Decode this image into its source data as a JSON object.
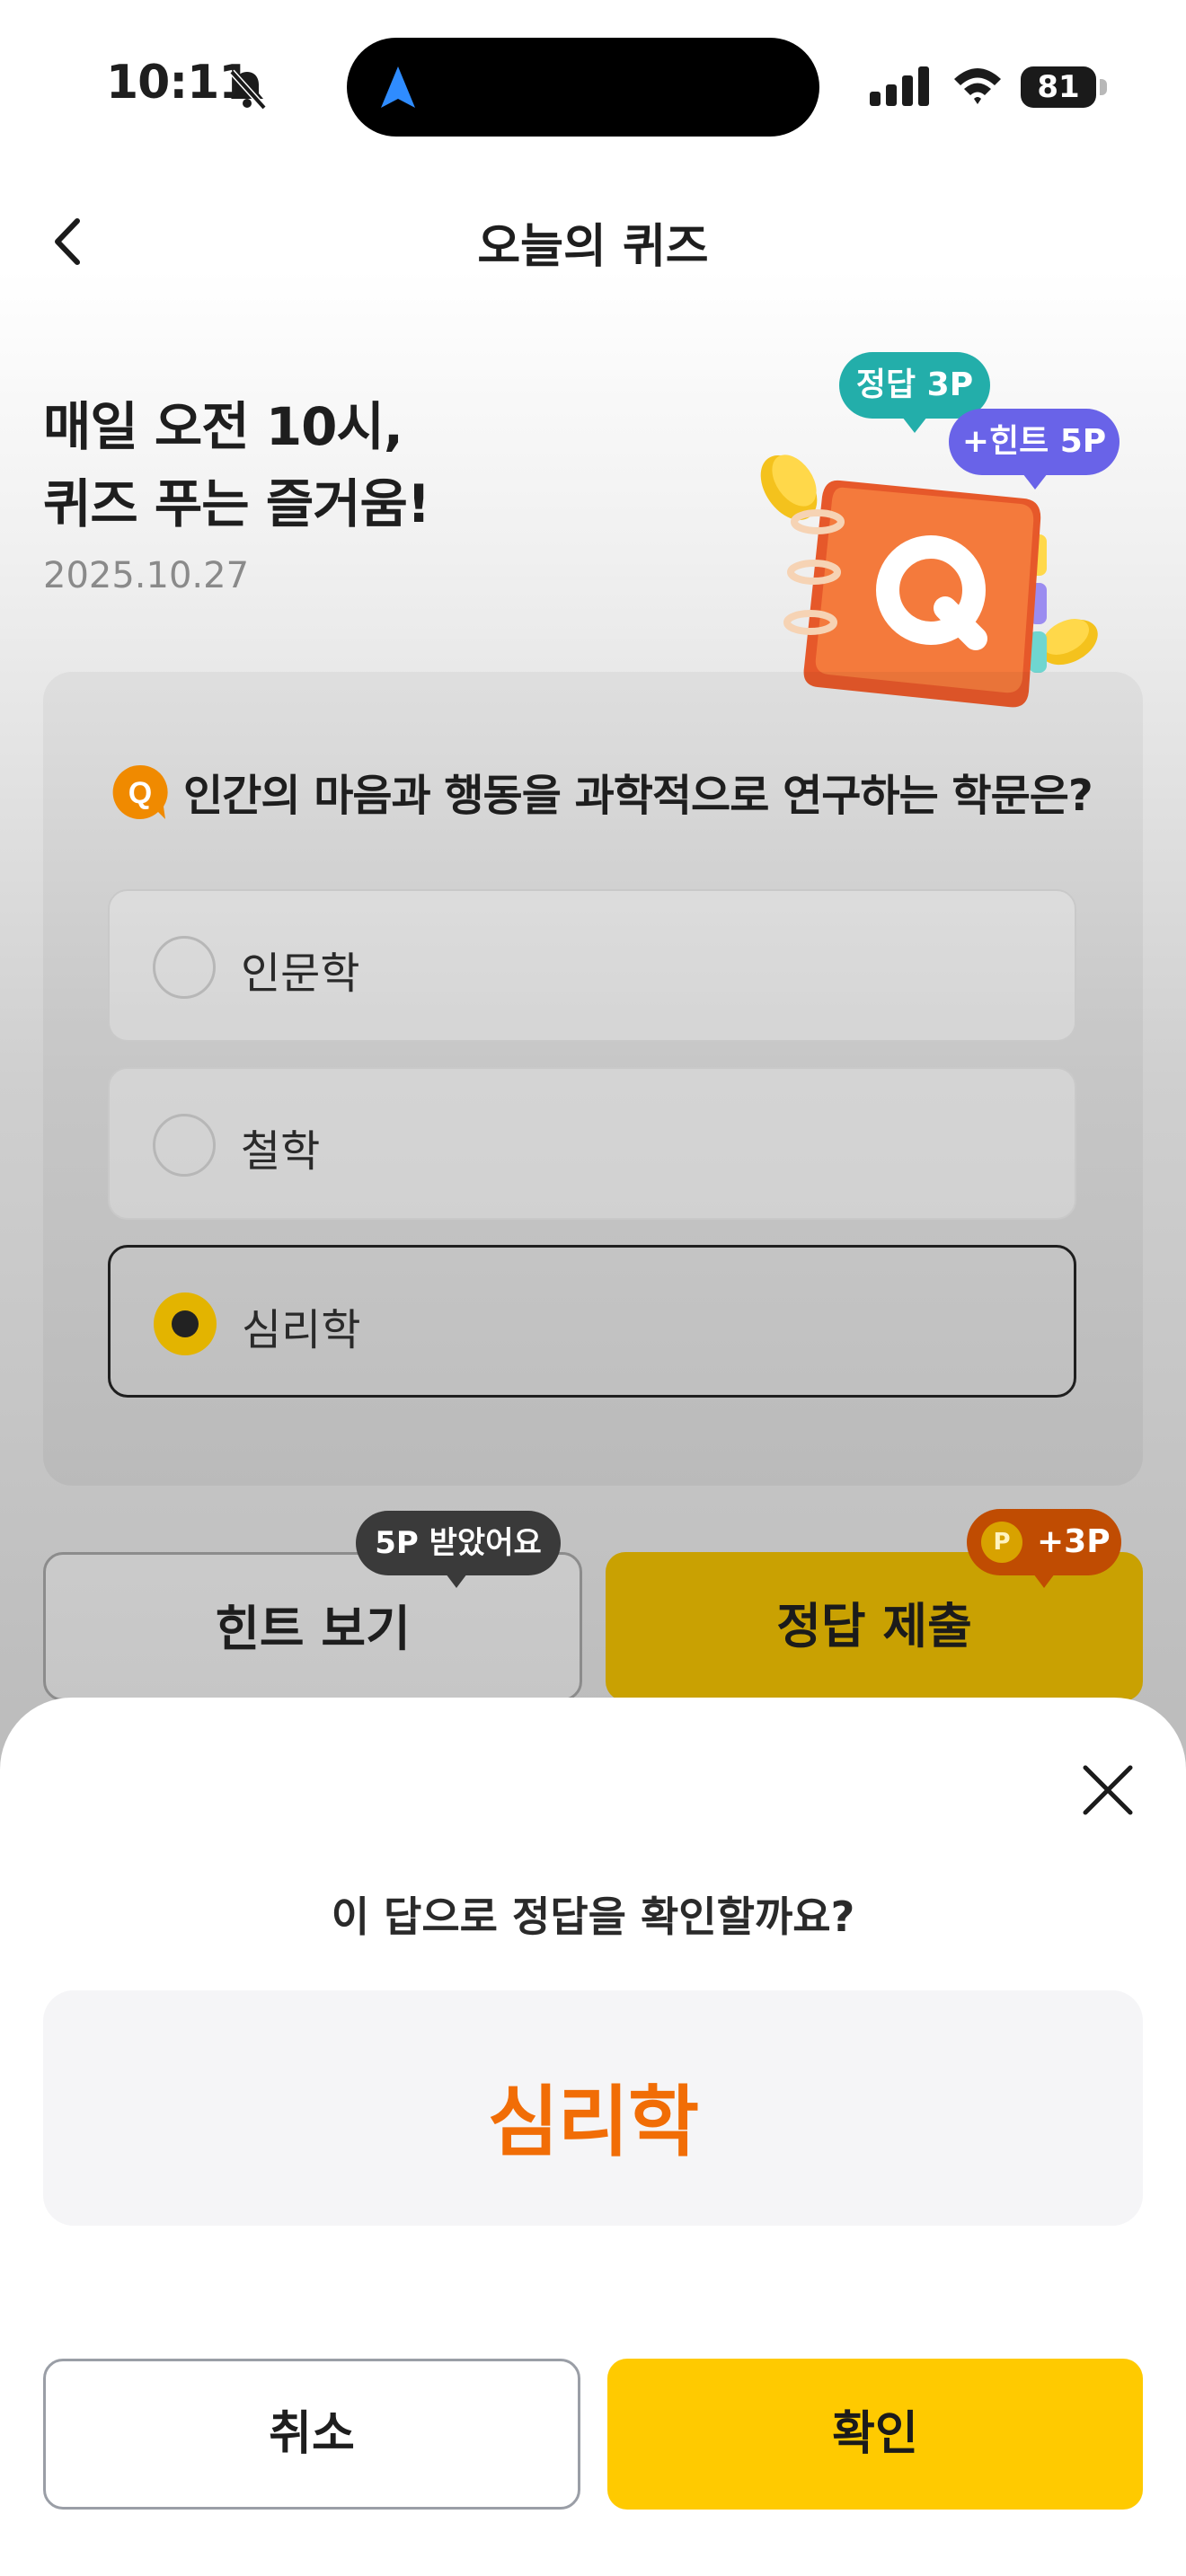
{
  "status_bar": {
    "time": "10:11",
    "battery": "81"
  },
  "header": {
    "title": "오늘의 퀴즈"
  },
  "hero": {
    "line1": "매일 오전 10시,",
    "line2": "퀴즈 푸는 즐거움!",
    "date": "2025.10.27",
    "badge_correct": "정답 3P",
    "badge_hint": "+힌트 5P"
  },
  "quiz": {
    "question_icon": "Q",
    "question": "인간의 마음과 행동을 과학적으로 연구하는 학문은?",
    "options": [
      {
        "label": "인문학",
        "selected": false
      },
      {
        "label": "철학",
        "selected": false
      },
      {
        "label": "심리학",
        "selected": true
      }
    ]
  },
  "actions": {
    "hint_label": "힌트 보기",
    "hint_tooltip": "5P 받았어요",
    "submit_label": "정답 제출",
    "submit_reward": "+3P",
    "coin_letter": "P"
  },
  "sheet": {
    "question": "이 답으로 정답을 확인할까요?",
    "answer": "심리학",
    "cancel_label": "취소",
    "confirm_label": "확인"
  },
  "colors": {
    "accent_yellow": "#ffca00",
    "answer_orange": "#f16d06",
    "badge_green": "#23aeaa",
    "badge_purple": "#6963e8"
  }
}
